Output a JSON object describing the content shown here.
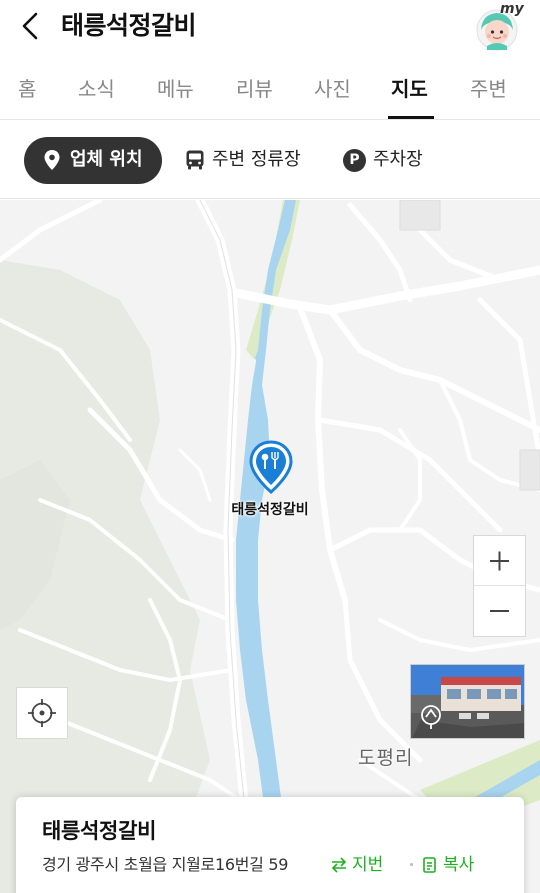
{
  "header": {
    "title": "태릉석정갈비",
    "avatar_text": "my"
  },
  "tabs": [
    {
      "label": "홈",
      "active": false
    },
    {
      "label": "소식",
      "active": false
    },
    {
      "label": "메뉴",
      "active": false
    },
    {
      "label": "리뷰",
      "active": false
    },
    {
      "label": "사진",
      "active": false
    },
    {
      "label": "지도",
      "active": true
    },
    {
      "label": "주변",
      "active": false
    }
  ],
  "filters": {
    "business_location": "업체 위치",
    "nearby_stops": "주변 정류장",
    "parking": "주차장",
    "parking_icon_text": "P"
  },
  "map": {
    "pin_label": "태릉석정갈비",
    "district_label": "도평리",
    "colors": {
      "river": "#a8d4f0",
      "park": "#dcebc6",
      "land": "#f3f3f3",
      "hill": "#e6e9e2",
      "road": "#ffffff"
    }
  },
  "infocard": {
    "name": "태릉석정갈비",
    "address": "경기 광주시 초월읍 지월로16번길 59",
    "jibun_label": "지번",
    "copy_label": "복사",
    "accent_color": "#1db31d"
  }
}
